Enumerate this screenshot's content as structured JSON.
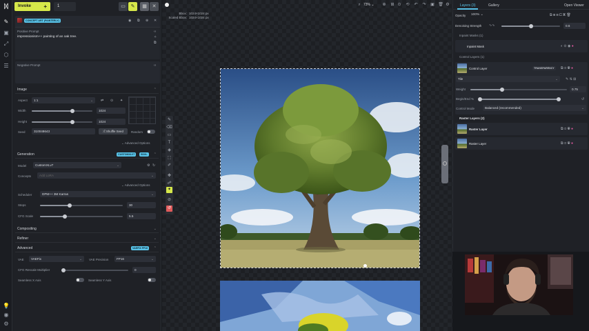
{
  "left_rail": {
    "icons": [
      "brush-icon",
      "image-icon",
      "workflow-icon",
      "models-icon",
      "queue-icon",
      "lightbulb-icon",
      "discord-icon",
      "settings-icon"
    ]
  },
  "header": {
    "invoke_label": "Invoke",
    "count_value": "1"
  },
  "model_card": {
    "badge": "CONCEPT ART (PAINTERLY)"
  },
  "prompts": {
    "positive_label": "Positive Prompt",
    "positive_value": "impressionism++ painting of an oak tree.",
    "negative_label": "Negative Prompt",
    "negative_value": ""
  },
  "image_section": {
    "title": "Image",
    "aspect_label": "Aspect",
    "aspect_value": "1:1",
    "width_label": "Width",
    "width_value": "1024",
    "height_label": "Height",
    "height_value": "1024",
    "seed_label": "Seed",
    "seed_value": "310048643",
    "shuffle_label": "Shuffle Seed",
    "random_label": "Random",
    "advanced_label": "Advanced Options"
  },
  "generation": {
    "title": "Generation",
    "badge1": "CUSTOMXLV7",
    "badge2": "SDXL",
    "model_label": "Model",
    "model_value": "CustomXLv7",
    "concepts_label": "Concepts",
    "concepts_placeholder": "Add LoRA",
    "advanced_label": "Advanced Options",
    "scheduler_label": "Scheduler",
    "scheduler_value": "DPM++ 3M Karras",
    "steps_label": "Steps",
    "steps_value": "30",
    "steps_fraction": 0.36,
    "cfg_label": "CFG Scale",
    "cfg_value": "5.5",
    "cfg_fraction": 0.3
  },
  "collapsed_sections": {
    "compositing": "Compositing",
    "refiner": "Refiner"
  },
  "advanced": {
    "title": "Advanced",
    "badge": "VAEFIX FP16",
    "vae_label": "VAE",
    "vae_value": "VAEFix",
    "precision_label": "VAE Precision",
    "precision_value": "FP16",
    "rescale_label": "CFG Rescale Multiplier",
    "rescale_value": "0",
    "seamless_x_label": "Seamless X Axis",
    "seamless_y_label": "Seamless Y Axis"
  },
  "canvas": {
    "zoom": "73%",
    "bbox_label": "Bbox:",
    "bbox_value": "1024×1024 px",
    "scaled_label": "Scaled Bbox:",
    "scaled_value": "1024×1024 px"
  },
  "right_panel": {
    "tab_layers": "Layers (3)",
    "tab_gallery": "Gallery",
    "open_viewer": "Open Viewer",
    "opacity_label": "Opacity",
    "opacity_value": "100%",
    "denoise_label": "Denoising Strength",
    "denoise_value": "0.6",
    "denoise_fraction": 0.5,
    "inpaint_header": "Inpaint Masks (1)",
    "inpaint_name": "Inpaint Mask",
    "control_header": "Control Layers (1)",
    "control_name": "Control Layer",
    "transparency_badge": "TRANSPARENCY",
    "control_model": "Tile",
    "weight_label": "Weight",
    "weight_value": "0.75",
    "weight_fraction": 0.33,
    "begin_end_label": "Begin/End %",
    "begin_fraction": 0.0,
    "end_fraction": 1.0,
    "control_mode_label": "Control Mode",
    "control_mode_value": "Balanced (recommended)",
    "raster_header": "Raster Layers (2)",
    "raster_layers": [
      {
        "name": "Raster Layer"
      },
      {
        "name": "Raster Layer"
      }
    ]
  },
  "colors": {
    "invoke_accent": "#d6e84a",
    "badge_cyan": "#59c3e8",
    "badge_yellow": "#d6e84a",
    "tool_active": "#d6e84a"
  }
}
